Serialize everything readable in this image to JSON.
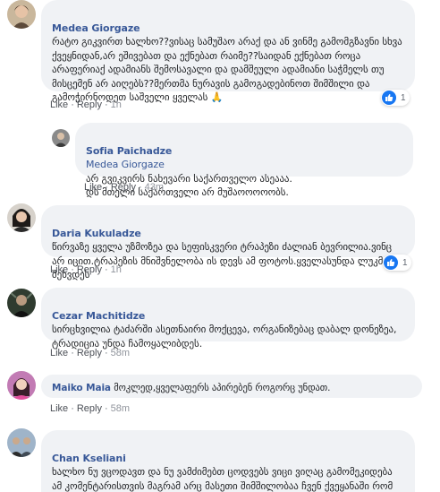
{
  "comments": [
    {
      "author": "Medea Giorgaze",
      "text": "რატო გიკვირთ ხალხო??ვისაც სამუშაო არაქ და ან ვინმე გამომგზავნი სხვა ქვეყნიდან,არ ეშივებათ და ექნებათ რაიმე??საიდან ექნებათ როცა არაფერიაქ ადამიანს შემოსავალი და დამშეული ადამიანი საჭმელს თუ მისცემენ არ აიღებს??მერთმა ნურავის გამოგადებინოთ შიმშილი და გამოჭირნოდეთ საშველი ყველას 🙏",
      "like": "Like",
      "reply": "Reply",
      "time": "1h",
      "reaction_count": "1"
    },
    {
      "author": "Sofia Paichadze",
      "mention": "Medea Giorgaze",
      "text": "არ გვიკვირს ნახევარი საქართველო ასეააა.\nდს მთელი საქართველი არ მუშაოოოოობს.",
      "like": "Like",
      "reply": "Reply",
      "time": "43m"
    },
    {
      "author": "Daria Kukuladze",
      "text": "წირვაზე ყველა უზმოზეა და სეფისკვერი ტრაპეზი ძალიან ბევრილია.ვინც არ იცით.ტრაპეზის მნიშვნელობა ის დევს ამ ფოტოს.ყველასუნდა ლუკმა შეხვდეს",
      "like": "Like",
      "reply": "Reply",
      "time": "1h",
      "reaction_count": "1"
    },
    {
      "author": "Cezar Machitidze",
      "text": "სირცხვილია ტაძარში ასეთნაირი მოქცევა, ორგანიზებაც დაბალ დონეზეა, ტრადიცია უნდა ჩამოყალიბდეს.",
      "like": "Like",
      "reply": "Reply",
      "time": "58m"
    },
    {
      "author": "Maiko Maia",
      "text": "მოკლედ,ყველაფერს აპირებენ როგორც უნდათ.",
      "like": "Like",
      "reply": "Reply",
      "time": "58m"
    },
    {
      "author": "Chan Kseliani",
      "text": "ხალხო ნუ ვცოდავთ და ნუ ვამძიმებთ ცოდვებს ვიცი ვიღაც გამომეკიდება ამ კომენტარისთვის მაგრამ არც მასეთი შიმშილობაა ჩვენ ქვეყანაში რომ ასეთი ვიდეოები დაიდოს და თუ კი გვშია ნურავის დავაბრალებთ საკუთარი",
      "like": "Like",
      "reply": "Reply"
    }
  ],
  "colors": {
    "author": "#385898",
    "bubble": "#f0f2f5",
    "like_badge": "#1877f2"
  }
}
